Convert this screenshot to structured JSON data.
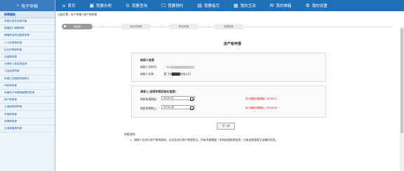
{
  "sidebar": {
    "header": "电子申报",
    "section": "税费缴纳",
    "items": [
      "申报记录查询或作废",
      "增值税小规模申报",
      "增值税及附加税费申报",
      "个人所得税申报",
      "企业所得税申报",
      "社保费申报",
      "分税种入库信息查询",
      "工会经费申报",
      "年度汇总纳税申报统计",
      "印花税申报",
      "年度电子申报明细情况查询",
      "房产税申报",
      "土地使用税申报",
      "车船税申报",
      "资源税申报",
      "土地增值税申报"
    ]
  },
  "topnav": [
    {
      "icon": "home-icon",
      "glyph": "⌂",
      "label": "首页"
    },
    {
      "icon": "tax-icon",
      "glyph": "▣",
      "label": "我要办税"
    },
    {
      "icon": "query-icon",
      "glyph": "⊙",
      "label": "我要查询"
    },
    {
      "icon": "appointment-icon",
      "glyph": "☐",
      "label": "我要预约"
    },
    {
      "icon": "guide-icon",
      "glyph": "▤",
      "label": "我要指引"
    },
    {
      "icon": "interaction-icon",
      "glyph": "▦",
      "label": "我的互动"
    },
    {
      "icon": "mail-icon",
      "glyph": "✉",
      "label": "我的邮箱"
    },
    {
      "icon": "settings-icon",
      "glyph": "⚙",
      "label": "我的设置"
    }
  ],
  "breadcrumb": "当前位置：电子申报→房产税申报",
  "steps": [
    "初始化",
    "填写申报表",
    "预览申报",
    "查看回执"
  ],
  "form_title": "房产税申报",
  "taxpayer": {
    "header": "纳税人信息",
    "id_label": "纳税人识别号:",
    "id_value": "91",
    "name_label": "纳税人名称:",
    "name_value": "厦门市████有限公司"
  },
  "init_info": {
    "header": "请录入:选择申报初始化信息:",
    "start_label": "税款所属期起:",
    "start_value": "2018-01",
    "end_label": "税款所属期止:",
    "end_value": "2018-06",
    "start_hint": "如: 税款所属期起: 2018-01",
    "end_hint": "如: 税款所属期止: 2018-06"
  },
  "next_button": "下一步",
  "notes": {
    "title": "申报说明:",
    "line1": "1、纳税人在进行房产税申报前，必须先进行房产税源登记。所有申报数据（名称房屋税源信息）均来自税源登记采集的信息。"
  },
  "colors": {
    "nav": "#1f6fb9",
    "sidebar_header": "#3b7cc0",
    "hint": "#ee0000"
  }
}
